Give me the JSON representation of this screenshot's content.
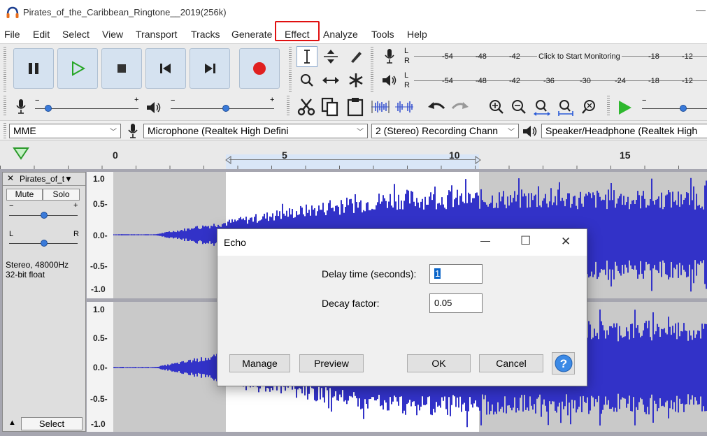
{
  "window": {
    "title": "Pirates_of_the_Caribbean_Ringtone__2019(256k)",
    "minimize_glyph": "—"
  },
  "menu": {
    "file": "File",
    "edit": "Edit",
    "select": "Select",
    "view": "View",
    "transport": "Transport",
    "tracks": "Tracks",
    "generate": "Generate",
    "effect": "Effect",
    "analyze": "Analyze",
    "tools": "Tools",
    "help": "Help"
  },
  "meters": {
    "record_ticks": [
      "-54",
      "-48",
      "-42",
      "-18",
      "-12"
    ],
    "record_hint": "Click to Start Monitoring",
    "play_ticks": [
      "-54",
      "-48",
      "-42",
      "-36",
      "-30",
      "-24",
      "-18",
      "-12"
    ],
    "channel_l": "L",
    "channel_r": "R"
  },
  "devices": {
    "host": "MME",
    "input": "Microphone (Realtek High Defini",
    "channels": "2 (Stereo) Recording Chann",
    "output": "Speaker/Headphone (Realtek High"
  },
  "timeline": {
    "ticks": [
      "0",
      "5",
      "10",
      "15"
    ]
  },
  "track": {
    "name": "Pirates_of_t▼",
    "close_glyph": "✕",
    "mute": "Mute",
    "solo": "Solo",
    "gain_minus": "−",
    "gain_plus": "+",
    "pan_l": "L",
    "pan_r": "R",
    "info_line1": "Stereo, 48000Hz",
    "info_line2": "32-bit float",
    "select": "Select",
    "collapse_glyph": "▲",
    "scale": [
      "1.0",
      "0.5-",
      "0.0-",
      "-0.5-",
      "-1.0"
    ]
  },
  "dialog": {
    "title": "Echo",
    "delay_label": "Delay time (seconds):",
    "delay_value": "1",
    "decay_label": "Decay factor:",
    "decay_value": "0.05",
    "manage": "Manage",
    "preview": "Preview",
    "ok": "OK",
    "cancel": "Cancel",
    "help_glyph": "?",
    "min_glyph": "—",
    "max_glyph": "☐",
    "close_glyph": "✕"
  },
  "colors": {
    "waveform": "#3232c8",
    "selection": "#ffffff",
    "highlight": "#e01010",
    "accent": "#3a7ad9"
  }
}
